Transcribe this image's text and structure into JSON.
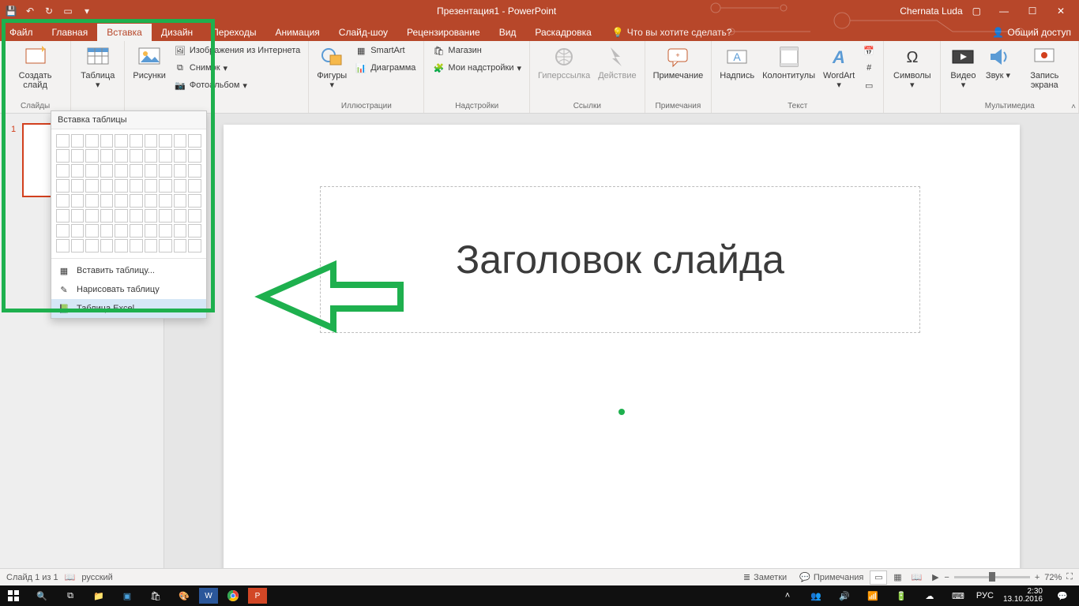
{
  "titlebar": {
    "document": "Презентация1 - PowerPoint",
    "user": "Chernata Luda"
  },
  "tabs": {
    "file": "Файл",
    "home": "Главная",
    "insert": "Вставка",
    "design": "Дизайн",
    "transitions": "Переходы",
    "animations": "Анимация",
    "slideshow": "Слайд-шоу",
    "review": "Рецензирование",
    "view": "Вид",
    "storyboarding": "Раскадровка",
    "tellme": "Что вы хотите сделать?",
    "share": "Общий доступ"
  },
  "ribbon": {
    "new_slide": "Создать слайд",
    "group_slides": "Слайды",
    "table": "Таблица",
    "pictures": "Рисунки",
    "online_pictures": "Изображения из Интернета",
    "screenshot": "Снимок",
    "photo_album": "Фотоальбом",
    "shapes": "Фигуры",
    "smartart": "SmartArt",
    "chart": "Диаграмма",
    "group_illustrations": "Иллюстрации",
    "store": "Магазин",
    "my_addins": "Мои надстройки",
    "group_addins": "Надстройки",
    "hyperlink": "Гиперссылка",
    "action": "Действие",
    "group_links": "Ссылки",
    "comment": "Примечание",
    "group_comments": "Примечания",
    "textbox": "Надпись",
    "header_footer": "Колонтитулы",
    "wordart": "WordArt",
    "group_text": "Текст",
    "symbols": "Символы",
    "video": "Видео",
    "audio": "Звук",
    "screen_recording": "Запись экрана",
    "group_media": "Мультимедиа"
  },
  "table_dropdown": {
    "title": "Вставка таблицы",
    "insert_table": "Вставить таблицу...",
    "draw_table": "Нарисовать таблицу",
    "excel_table": "Таблица Excel"
  },
  "slide": {
    "title_placeholder": "Заголовок слайда"
  },
  "thumbnail": {
    "index": "1"
  },
  "statusbar": {
    "slide_of": "Слайд 1 из 1",
    "language": "русский",
    "notes": "Заметки",
    "comments": "Примечания",
    "zoom_value": "72%"
  },
  "taskbar": {
    "lang": "РУС",
    "time": "2:30",
    "date": "13.10.2016"
  }
}
